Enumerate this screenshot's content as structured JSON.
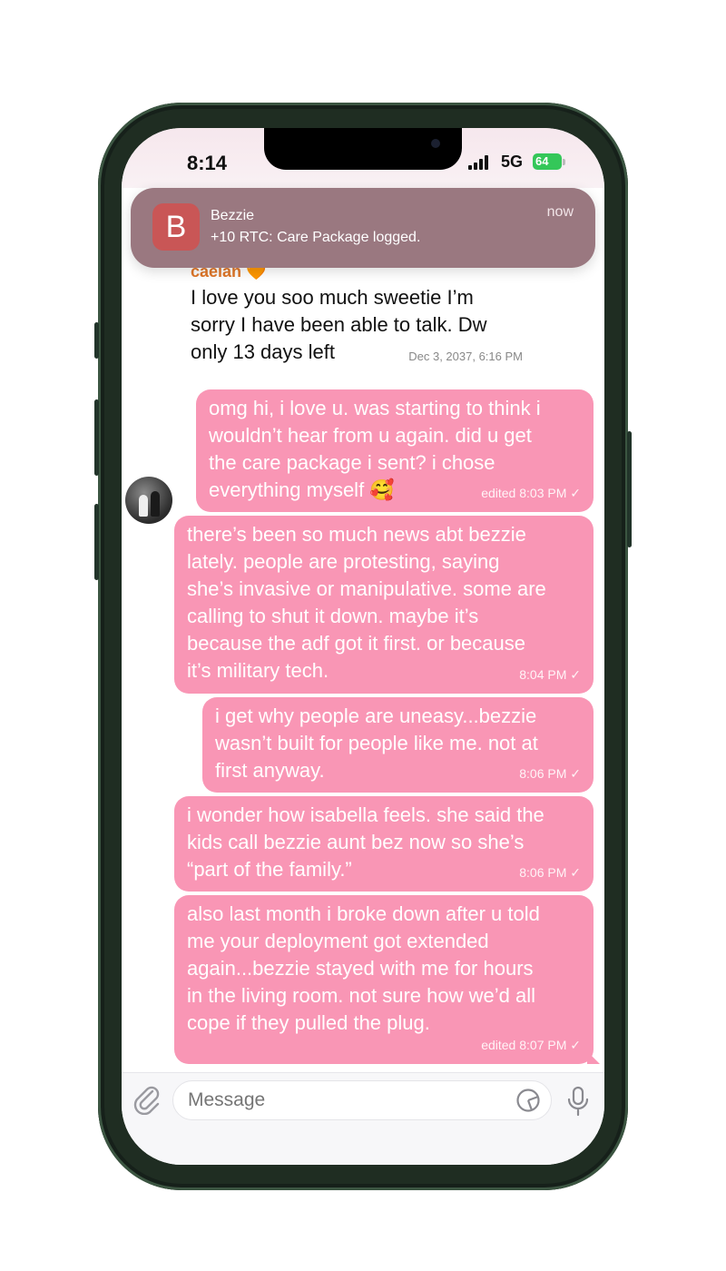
{
  "status": {
    "time": "8:14",
    "network": "5G",
    "battery": "64"
  },
  "notification": {
    "app_initial": "B",
    "app_name": "Bezzie",
    "body": "+10 RTC: Care Package logged.",
    "time": "now"
  },
  "incoming": {
    "sender": "caelan 🧡",
    "lines": [
      "I love you soo much sweetie I’m",
      "sorry I have been able to talk. Dw",
      "only 13 days left"
    ],
    "time": "Dec 3, 2037, 6:16 PM"
  },
  "outgoing": [
    {
      "lines": [
        "omg hi, i love u. was starting to think i",
        "wouldn’t hear from u again. did u get",
        "the care package i sent? i chose",
        "everything myself 🥰"
      ],
      "meta": "edited 8:03 PM ✓"
    },
    {
      "lines": [
        "there’s been so much news abt bezzie",
        "lately. people are protesting, saying",
        "she’s invasive or manipulative. some are",
        "calling to shut it down. maybe it’s",
        "because the adf got it first. or because",
        "it’s military tech."
      ],
      "meta": "8:04 PM ✓"
    },
    {
      "lines": [
        "i get why people are uneasy...bezzie",
        "wasn’t built for people like me. not at",
        "first anyway."
      ],
      "meta": "8:06 PM ✓"
    },
    {
      "lines": [
        "i wonder how isabella feels. she said the",
        "kids call bezzie aunt bez now so she’s",
        "“part of the family.”"
      ],
      "meta": "8:06 PM ✓"
    },
    {
      "lines": [
        "also last month i broke down after u told",
        "me your deployment got extended",
        "again...bezzie stayed with me for hours",
        "in the living room. not sure how we’d all",
        "cope if they pulled the plug."
      ],
      "meta": "edited 8:07 PM ✓"
    }
  ],
  "composer": {
    "placeholder": "Message"
  },
  "icons": {
    "attach": "paperclip-icon",
    "sticker": "sticker-icon",
    "mic": "microphone-icon"
  },
  "colors": {
    "outgoing_bubble": "#f996b5",
    "sender_name": "#e0782a",
    "notification_bg": "#9a7880",
    "app_icon": "#c95656"
  }
}
